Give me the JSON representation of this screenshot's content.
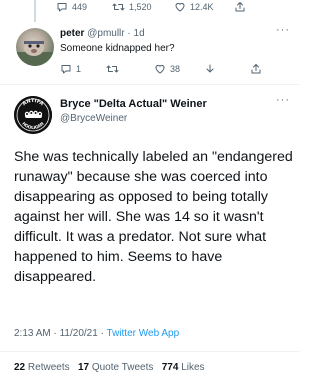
{
  "prev_tweet": {
    "reply_count": "449",
    "retweet_count": "1,520",
    "like_count": "12.4K"
  },
  "reply": {
    "name": "peter",
    "handle": "@pmullr",
    "separator": "·",
    "time": "1d",
    "text": "Someone kidnapped her?",
    "reply_count": "1",
    "retweet_count": "",
    "like_count": "38",
    "more": "···"
  },
  "tweet": {
    "author_name": "Bryce \"Delta Actual\" Weiner",
    "author_handle": "@BryceWeiner",
    "avatar_text_top": "ANTIFA",
    "avatar_text_bottom": "HOOLIGAN",
    "more": "···",
    "body": "She was technically labeled an \"endangered runaway\" because she was coerced into disappearing as opposed to being totally against her will. She was 14 so it wasn't difficult. It was a predator. Not sure what happened to him. Seems to have disappeared.",
    "time": "2:13 AM",
    "dot": "·",
    "date": "11/20/21",
    "source": "Twitter Web App",
    "retweets_count": "22",
    "retweets_label": "Retweets",
    "quotes_count": "17",
    "quotes_label": "Quote Tweets",
    "likes_count": "774",
    "likes_label": "Likes"
  },
  "colors": {
    "text": "#0f1419",
    "secondary": "#536471",
    "link": "#1d9bf0",
    "divider": "#eff3f4"
  }
}
